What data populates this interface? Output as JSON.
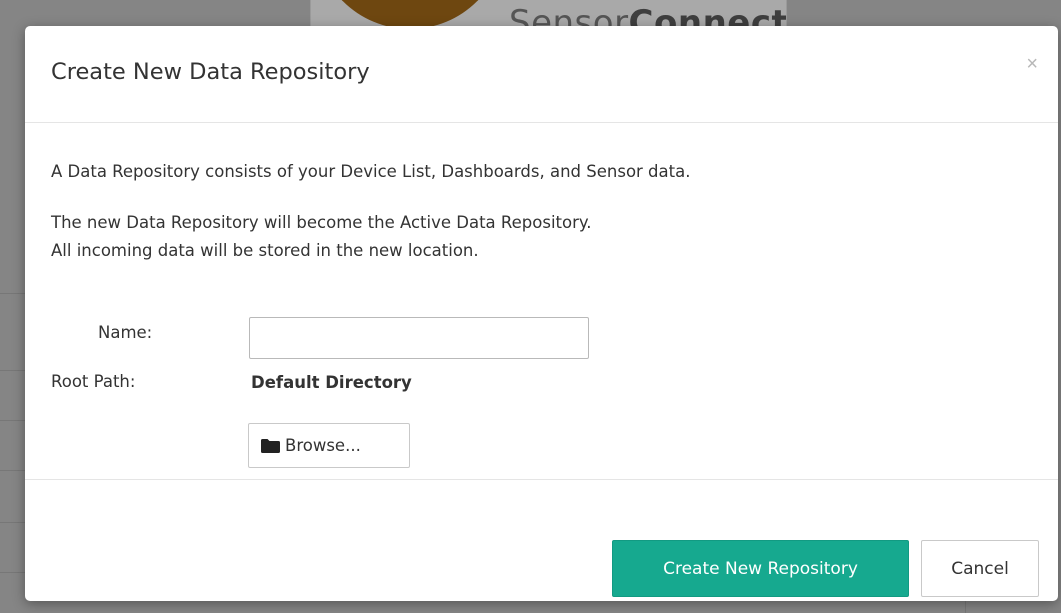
{
  "background": {
    "logo_text_light": "Sensor",
    "logo_text_bold": "Connect",
    "logo_tm": "™"
  },
  "dialog": {
    "title": "Create New Data Repository",
    "close_glyph": "×",
    "description_line1": "A Data Repository consists of your Device List, Dashboards, and Sensor data.",
    "description_line2": "The new Data Repository will become the Active Data Repository.",
    "description_line3": "All incoming data will be stored in the new location.",
    "form": {
      "name_label": "Name:",
      "name_value": "",
      "root_path_label": "Root Path:",
      "root_path_value": "Default Directory",
      "browse_label": "Browse...",
      "browse_icon": "folder-icon"
    },
    "footer": {
      "create_label": "Create New Repository",
      "cancel_label": "Cancel"
    }
  },
  "colors": {
    "primary": "#16a98f",
    "overlay": "#858585"
  }
}
